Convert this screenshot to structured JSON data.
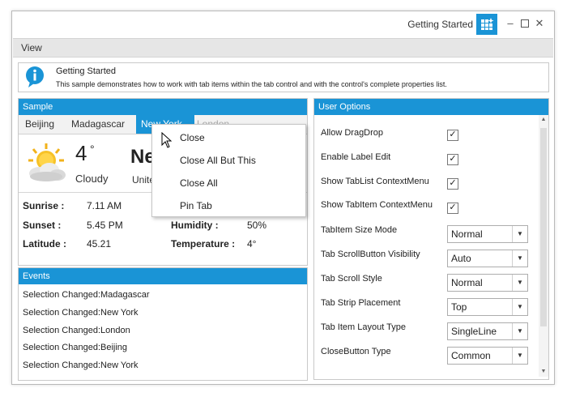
{
  "window": {
    "title": "Getting Started"
  },
  "menu": {
    "items": [
      "View"
    ]
  },
  "info": {
    "title": "Getting Started",
    "description": "This sample demonstrates how to work with tab items within the tab control and with the control's complete properties list."
  },
  "sample": {
    "header": "Sample",
    "tabs": [
      {
        "label": "Beijing",
        "active": false
      },
      {
        "label": "Madagascar",
        "active": false
      },
      {
        "label": "New York",
        "active": true
      },
      {
        "label": "London",
        "active": false
      }
    ],
    "weather": {
      "temperature": "4",
      "degree": "°",
      "condition": "Cloudy",
      "city": "New York",
      "country": "United States",
      "sunrise_label": "Sunrise :",
      "sunrise": "7.11 AM",
      "sunset_label": "Sunset :",
      "sunset": "5.45 PM",
      "latitude_label": "Latitude :",
      "latitude": "45.21",
      "humidity_label": "Humidity :",
      "humidity": "50%",
      "temp_label": "Temperature :",
      "temp_value": "4°"
    }
  },
  "context_menu": {
    "items": [
      "Close",
      "Close All But This",
      "Close All",
      "Pin Tab"
    ]
  },
  "events": {
    "header": "Events",
    "items": [
      "Selection Changed:Madagascar",
      "Selection Changed:New York",
      "Selection Changed:London",
      "Selection Changed:Beijing",
      "Selection Changed:New York"
    ]
  },
  "user_options": {
    "header": "User Options",
    "checkboxes": [
      {
        "label": "Allow DragDrop",
        "checked": true
      },
      {
        "label": "Enable Label Edit",
        "checked": true
      },
      {
        "label": "Show TabList ContextMenu",
        "checked": true
      },
      {
        "label": "Show TabItem ContextMenu",
        "checked": true
      }
    ],
    "selects": [
      {
        "label": "TabItem Size Mode",
        "value": "Normal"
      },
      {
        "label": "Tab ScrollButton Visibility",
        "value": "Auto"
      },
      {
        "label": "Tab Scroll Style",
        "value": "Normal"
      },
      {
        "label": "Tab Strip Placement",
        "value": "Top"
      },
      {
        "label": "Tab Item Layout Type",
        "value": "SingleLine"
      },
      {
        "label": "CloseButton Type",
        "value": "Common"
      }
    ]
  },
  "colors": {
    "accent": "#1a94d6"
  }
}
